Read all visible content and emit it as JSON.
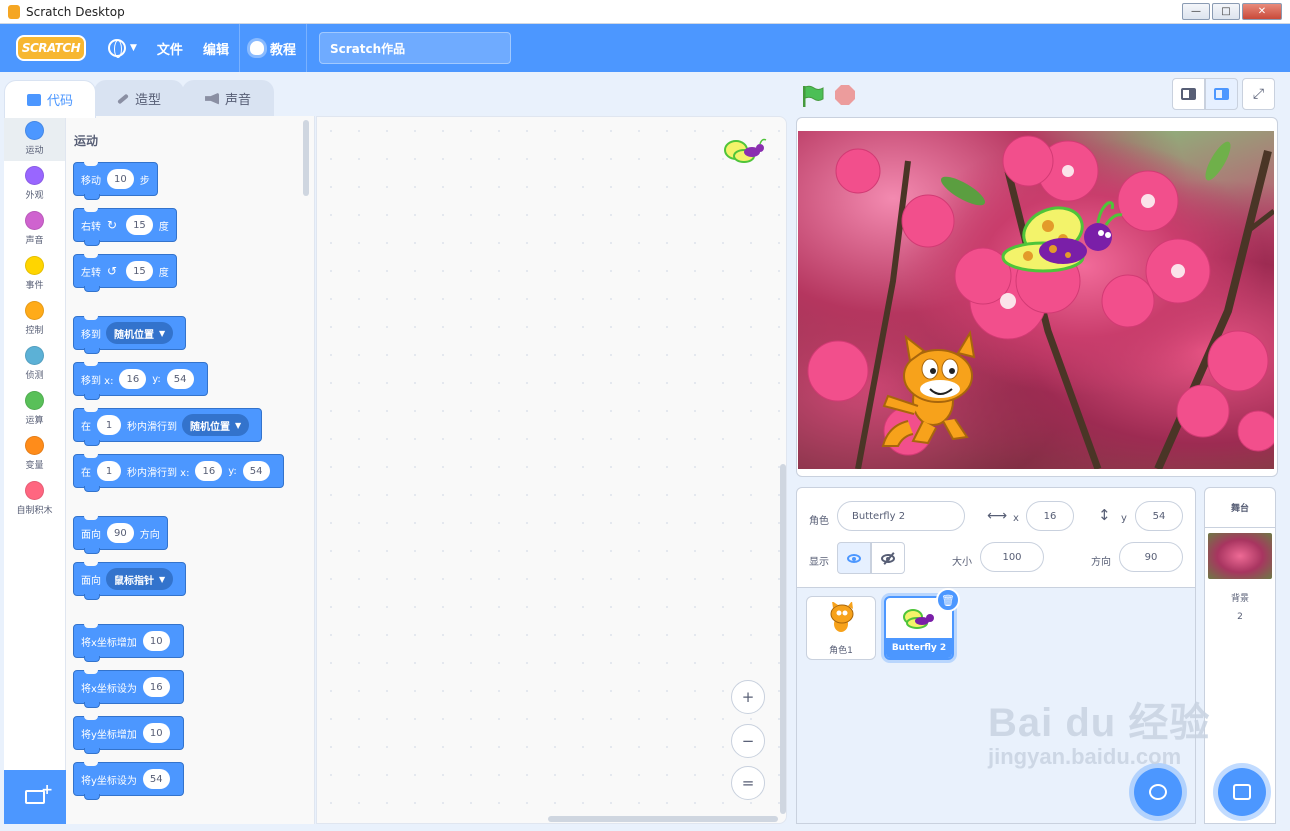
{
  "window": {
    "title": "Scratch Desktop"
  },
  "menubar": {
    "logo": "SCRATCH",
    "file": "文件",
    "edit": "编辑",
    "tutorials": "教程",
    "project_title": "Scratch作品"
  },
  "tabs": [
    {
      "label": "代码"
    },
    {
      "label": "造型"
    },
    {
      "label": "声音"
    }
  ],
  "categories": [
    {
      "label": "运动",
      "color": "#4c97ff"
    },
    {
      "label": "外观",
      "color": "#9966ff"
    },
    {
      "label": "声音",
      "color": "#cf63cf"
    },
    {
      "label": "事件",
      "color": "#ffd500"
    },
    {
      "label": "控制",
      "color": "#ffab19"
    },
    {
      "label": "侦测",
      "color": "#5cb1d6"
    },
    {
      "label": "运算",
      "color": "#59c059"
    },
    {
      "label": "变量",
      "color": "#ff8c1a"
    },
    {
      "label": "自制积木",
      "color": "#ff6680"
    }
  ],
  "palette": {
    "heading": "运动",
    "move": {
      "a": "移动",
      "v": "10",
      "b": "步"
    },
    "turn_right": {
      "a": "右转",
      "v": "15",
      "b": "度"
    },
    "turn_left": {
      "a": "左转",
      "v": "15",
      "b": "度"
    },
    "goto": {
      "a": "移到",
      "d": "随机位置"
    },
    "goto_xy": {
      "a": "移到 x:",
      "x": "16",
      "b": "y:",
      "y": "54"
    },
    "glide": {
      "a": "在",
      "v": "1",
      "b": "秒内滑行到",
      "d": "随机位置"
    },
    "glide_xy": {
      "a": "在",
      "v": "1",
      "b": "秒内滑行到 x:",
      "x": "16",
      "c": "y:",
      "y": "54"
    },
    "point_dir": {
      "a": "面向",
      "v": "90",
      "b": "方向"
    },
    "point_towards": {
      "a": "面向",
      "d": "鼠标指针"
    },
    "change_x": {
      "a": "将x坐标增加",
      "v": "10"
    },
    "set_x": {
      "a": "将x坐标设为",
      "v": "16"
    },
    "change_y": {
      "a": "将y坐标增加",
      "v": "10"
    },
    "set_y": {
      "a": "将y坐标设为",
      "v": "54"
    }
  },
  "zoom": {
    "in": "+",
    "out": "−",
    "reset": "="
  },
  "sprite_info": {
    "sprite_label": "角色",
    "sprite_name": "Butterfly 2",
    "x_label": "x",
    "x": "16",
    "y_label": "y",
    "y": "54",
    "show_label": "显示",
    "size_label": "大小",
    "size": "100",
    "direction_label": "方向",
    "direction": "90"
  },
  "sprites": [
    {
      "name": "角色1"
    },
    {
      "name": "Butterfly 2"
    }
  ],
  "stage_pane": {
    "header": "舞台",
    "backdrops_label": "背景",
    "backdrops_count": "2"
  },
  "watermark": {
    "top": "Bai du 经验",
    "bottom": "jingyan.baidu.com"
  }
}
